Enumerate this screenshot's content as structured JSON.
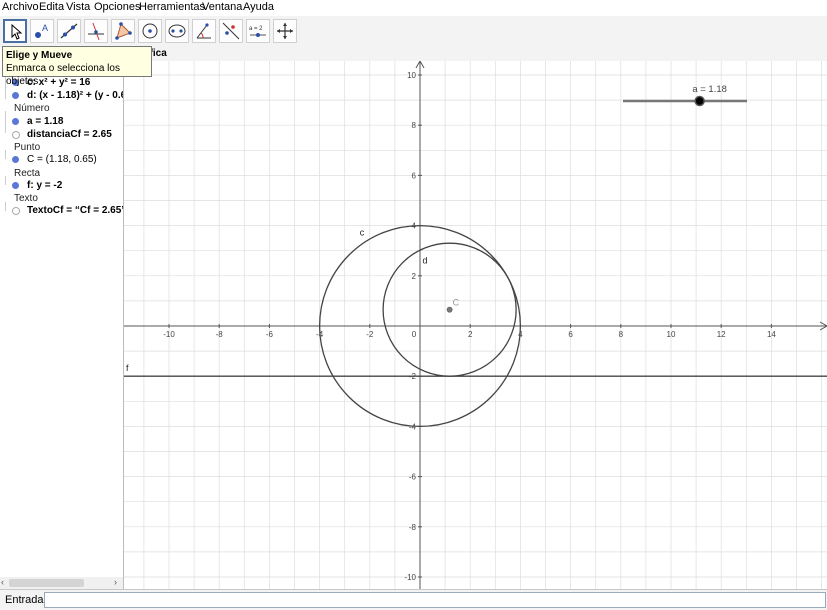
{
  "menu": [
    "Archivo",
    "Edita",
    "Vista",
    "Opciones",
    "Herramientas",
    "Ventana",
    "Ayuda"
  ],
  "toolbar": {
    "tools": [
      "move-tool",
      "point-tool",
      "line-tool",
      "perpendicular-tool",
      "polygon-tool",
      "circle-tool",
      "conic-tool",
      "angle-tool",
      "reflect-tool",
      "slider-tool",
      "move-view-tool"
    ],
    "slider_tool_text": "a = 2"
  },
  "tooltip": {
    "title": "Elige y Mueve",
    "text": "Enmarca o selecciona los objetos"
  },
  "algebra": {
    "items": [
      {
        "kind": "obj",
        "text": "c: x² + y² = 16",
        "visible": true
      },
      {
        "kind": "obj",
        "text": "d: (x - 1.18)² + (y - 0.6",
        "visible": true
      },
      {
        "kind": "cat",
        "text": "Número"
      },
      {
        "kind": "obj",
        "text": "a = 1.18",
        "visible": true
      },
      {
        "kind": "obj",
        "text": "distanciaCf = 2.65",
        "visible": false
      },
      {
        "kind": "cat",
        "text": "Punto"
      },
      {
        "kind": "obj",
        "text": "C = (1.18, 0.65)",
        "visible": true
      },
      {
        "kind": "cat",
        "text": "Recta"
      },
      {
        "kind": "obj",
        "text": "f: y = -2",
        "visible": true
      },
      {
        "kind": "cat",
        "text": "Texto"
      },
      {
        "kind": "obj",
        "text": "TextoCf = “Cf = 2.65”",
        "visible": false
      }
    ]
  },
  "graphics_title": "a Gráfica",
  "graphics": {
    "x_ticks": [
      -10,
      -8,
      -6,
      -4,
      -2,
      0,
      2,
      4,
      6,
      8,
      10,
      12,
      14
    ],
    "y_ticks": [
      -10,
      -8,
      -6,
      -4,
      -2,
      2,
      4,
      6,
      8,
      10
    ],
    "circle_c": {
      "label": "c",
      "cx": 0,
      "cy": 0,
      "r": 4
    },
    "circle_d": {
      "label": "d",
      "cx": 1.18,
      "cy": 0.65,
      "r": 2.65
    },
    "point_C": {
      "label": "C",
      "x": 1.18,
      "y": 0.65
    },
    "line_f": {
      "label": "f",
      "y": -2
    },
    "slider": {
      "label": "a = 1.18",
      "value": 1.18,
      "min": -5,
      "max": 5
    },
    "colors": {
      "curve": "#444444",
      "grid": "#dddddd",
      "point": "#7a7a7a",
      "slider": "#777777"
    }
  },
  "input": {
    "label": "Entrada:"
  }
}
